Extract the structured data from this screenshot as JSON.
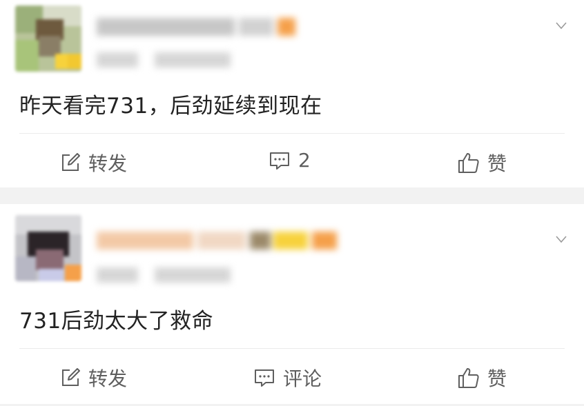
{
  "colors": {
    "text_primary": "#222222",
    "text_action": "#5e5e5e",
    "separator": "#f2f2f2",
    "badge_orange": "#f5a04a",
    "badge_yellow": "#f7d23c"
  },
  "icons": {
    "repost": "edit-square-icon",
    "comment": "comment-icon",
    "like": "thumbs-up-icon",
    "expand": "chevron-down-icon"
  },
  "posts": [
    {
      "content": "昨天看完731，后劲延续到现在",
      "actions": {
        "repost": "转发",
        "comment": "2",
        "like": "赞"
      }
    },
    {
      "content": "731后劲太大了救命",
      "actions": {
        "repost": "转发",
        "comment": "评论",
        "like": "赞"
      }
    }
  ]
}
